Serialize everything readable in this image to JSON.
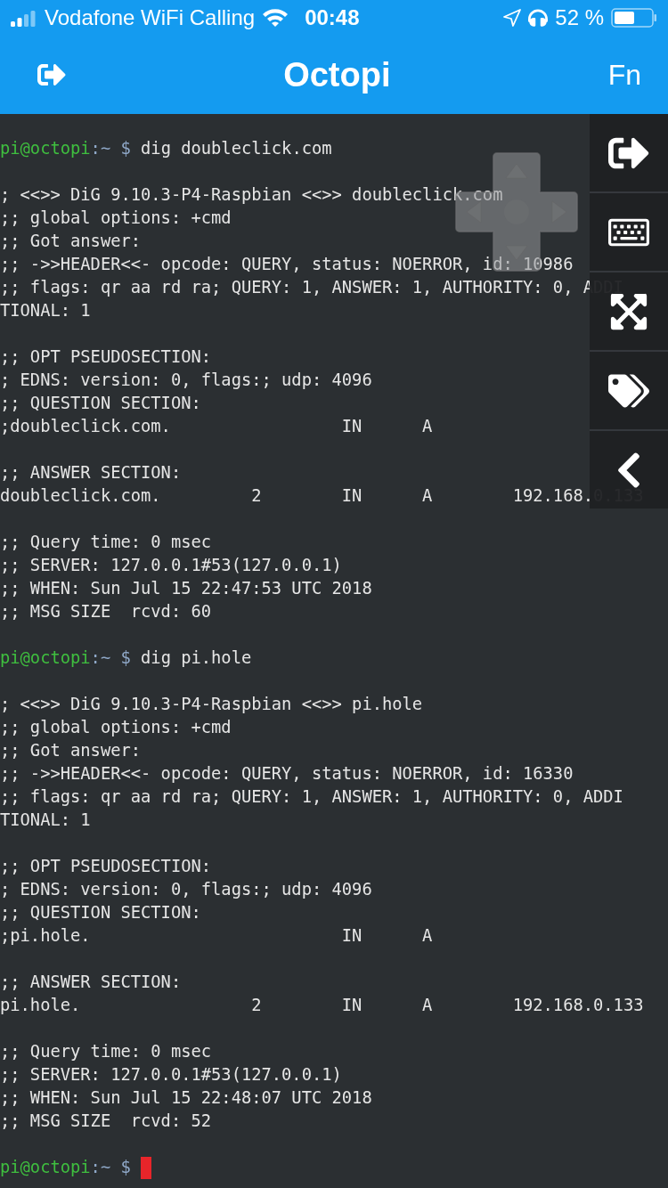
{
  "status_bar": {
    "carrier": "Vodafone WiFi Calling",
    "time": "00:48",
    "battery": "52 %"
  },
  "nav": {
    "title": "Octopi",
    "right_button": "Fn"
  },
  "terminal": {
    "lines": [
      {
        "kind": "prompt",
        "user": "pi@octopi",
        "path": ":~ $",
        "command": "dig doubleclick.com",
        "cursor": false
      },
      {
        "kind": "blank"
      },
      {
        "kind": "output",
        "text": "; <<>> DiG 9.10.3-P4-Raspbian <<>> doubleclick.com"
      },
      {
        "kind": "output",
        "text": ";; global options: +cmd"
      },
      {
        "kind": "output",
        "text": ";; Got answer:"
      },
      {
        "kind": "output",
        "text": ";; ->>HEADER<<- opcode: QUERY, status: NOERROR, id: 10986"
      },
      {
        "kind": "output",
        "text": ";; flags: qr aa rd ra; QUERY: 1, ANSWER: 1, AUTHORITY: 0, ADDI"
      },
      {
        "kind": "output",
        "text": "TIONAL: 1"
      },
      {
        "kind": "blank"
      },
      {
        "kind": "output",
        "text": ";; OPT PSEUDOSECTION:"
      },
      {
        "kind": "output",
        "text": "; EDNS: version: 0, flags:; udp: 4096"
      },
      {
        "kind": "output",
        "text": ";; QUESTION SECTION:"
      },
      {
        "kind": "output",
        "text": ";doubleclick.com.                 IN      A"
      },
      {
        "kind": "blank"
      },
      {
        "kind": "output",
        "text": ";; ANSWER SECTION:"
      },
      {
        "kind": "output",
        "text": "doubleclick.com.         2        IN      A        192.168.0.133"
      },
      {
        "kind": "blank"
      },
      {
        "kind": "output",
        "text": ";; Query time: 0 msec"
      },
      {
        "kind": "output",
        "text": ";; SERVER: 127.0.0.1#53(127.0.0.1)"
      },
      {
        "kind": "output",
        "text": ";; WHEN: Sun Jul 15 22:47:53 UTC 2018"
      },
      {
        "kind": "output",
        "text": ";; MSG SIZE  rcvd: 60"
      },
      {
        "kind": "blank"
      },
      {
        "kind": "prompt",
        "user": "pi@octopi",
        "path": ":~ $",
        "command": "dig pi.hole",
        "cursor": false
      },
      {
        "kind": "blank"
      },
      {
        "kind": "output",
        "text": "; <<>> DiG 9.10.3-P4-Raspbian <<>> pi.hole"
      },
      {
        "kind": "output",
        "text": ";; global options: +cmd"
      },
      {
        "kind": "output",
        "text": ";; Got answer:"
      },
      {
        "kind": "output",
        "text": ";; ->>HEADER<<- opcode: QUERY, status: NOERROR, id: 16330"
      },
      {
        "kind": "output",
        "text": ";; flags: qr aa rd ra; QUERY: 1, ANSWER: 1, AUTHORITY: 0, ADDI"
      },
      {
        "kind": "output",
        "text": "TIONAL: 1"
      },
      {
        "kind": "blank"
      },
      {
        "kind": "output",
        "text": ";; OPT PSEUDOSECTION:"
      },
      {
        "kind": "output",
        "text": "; EDNS: version: 0, flags:; udp: 4096"
      },
      {
        "kind": "output",
        "text": ";; QUESTION SECTION:"
      },
      {
        "kind": "output",
        "text": ";pi.hole.                         IN      A"
      },
      {
        "kind": "blank"
      },
      {
        "kind": "output",
        "text": ";; ANSWER SECTION:"
      },
      {
        "kind": "output",
        "text": "pi.hole.                 2        IN      A        192.168.0.133"
      },
      {
        "kind": "blank"
      },
      {
        "kind": "output",
        "text": ";; Query time: 0 msec"
      },
      {
        "kind": "output",
        "text": ";; SERVER: 127.0.0.1#53(127.0.0.1)"
      },
      {
        "kind": "output",
        "text": ";; WHEN: Sun Jul 15 22:48:07 UTC 2018"
      },
      {
        "kind": "output",
        "text": ";; MSG SIZE  rcvd: 52"
      },
      {
        "kind": "blank"
      },
      {
        "kind": "prompt",
        "user": "pi@octopi",
        "path": ":~ $",
        "cursor": true
      }
    ]
  }
}
